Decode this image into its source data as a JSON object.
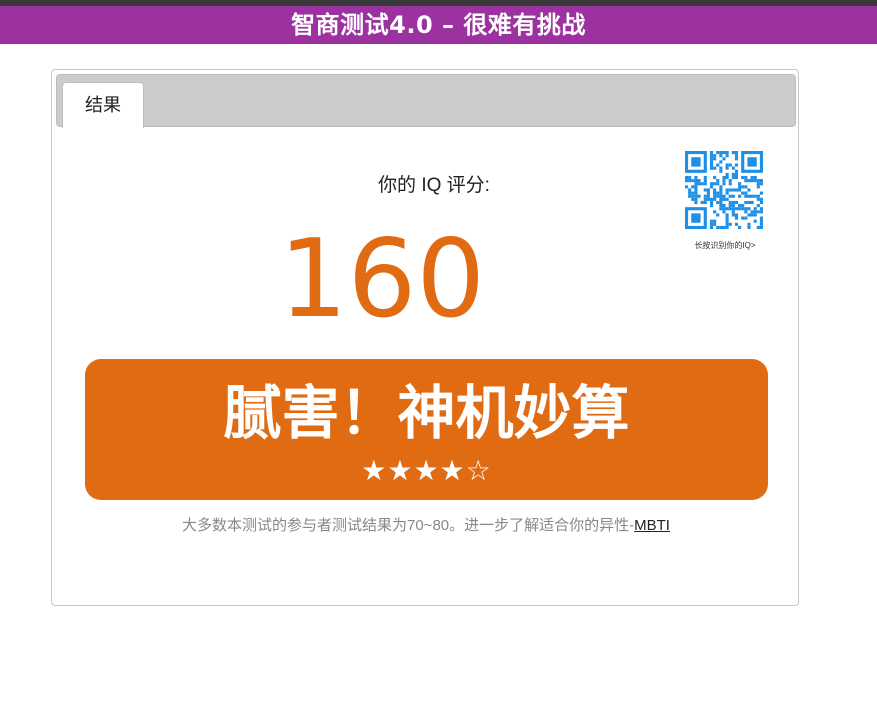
{
  "header": {
    "title": "智商测试4.0 – 很难有挑战"
  },
  "tabs": [
    {
      "label": "结果"
    }
  ],
  "result": {
    "score_label": "你的 IQ 评分:",
    "score": "160",
    "banner_title": "腻害！神机妙算",
    "stars": "★★★★☆",
    "stars_value": 4,
    "stars_max": 5
  },
  "qr": {
    "caption": "长按识别你的IQ>"
  },
  "footer": {
    "note": "大多数本测试的参与者测试结果为70~80。进一步了解适合你的异性-",
    "link": "MBTI"
  },
  "colors": {
    "header_bg": "#9b32a0",
    "accent": "#e06b13",
    "qr": "#1e8fe6"
  }
}
